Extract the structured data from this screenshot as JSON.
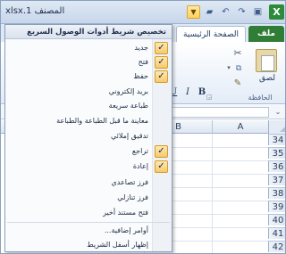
{
  "window": {
    "title": "المصنف 1.xlsx"
  },
  "quick_access": {
    "customize_icon": "qat-dropdown-icon",
    "icons": [
      "folder-open-icon",
      "undo-icon",
      "redo-icon",
      "save-icon"
    ]
  },
  "ribbon": {
    "tabs": [
      {
        "label": "ملف"
      },
      {
        "label": "الصفحة الرئيسية"
      }
    ],
    "clipboard": {
      "paste_label": "لصق",
      "group_label": "الحافظة"
    },
    "font_buttons": {
      "bold": "B",
      "italic": "I",
      "underline": "U"
    }
  },
  "grid": {
    "columns": [
      "A",
      "B"
    ],
    "rows": [
      "34",
      "35",
      "36",
      "37",
      "38",
      "39",
      "40",
      "41",
      "42"
    ]
  },
  "menu": {
    "title": "تخصيص شريط أدوات الوصول السريع",
    "items": [
      {
        "label": "جديد",
        "checked": true
      },
      {
        "label": "فتح",
        "checked": true
      },
      {
        "label": "حفظ",
        "checked": true
      },
      {
        "label": "بريد إلكتروني",
        "checked": false
      },
      {
        "label": "طباعة سريعة",
        "checked": false
      },
      {
        "label": "معاينة ما قبل الطباعة والطباعة",
        "checked": false
      },
      {
        "label": "تدقيق إملائي",
        "checked": false
      },
      {
        "label": "تراجع",
        "checked": true
      },
      {
        "label": "إعادة",
        "checked": true
      },
      {
        "label": "فرز تصاعدي",
        "checked": false
      },
      {
        "label": "فرز تنازلي",
        "checked": false
      },
      {
        "label": "فتح مستند أخير",
        "checked": false
      },
      {
        "label": "أوامر إضافية...",
        "checked": false
      },
      {
        "label": "إظهار أسفل الشريط",
        "checked": false
      }
    ],
    "check_mark": "✓"
  },
  "colors": {
    "accent": "#2f7d36",
    "check_bg": "#f7c96b",
    "ribbon_tab_text": "#1e3b66"
  }
}
